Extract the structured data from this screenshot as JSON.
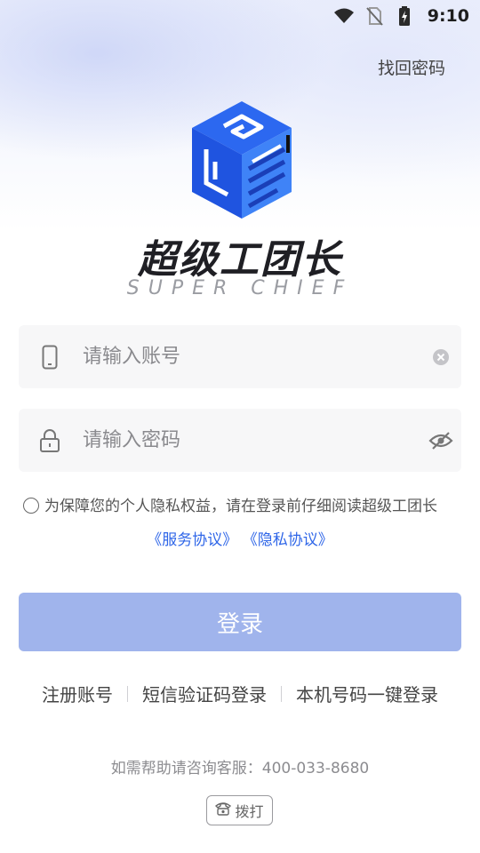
{
  "status_bar": {
    "time": "9:10",
    "icons": [
      "wifi-icon",
      "no-sim-icon",
      "battery-charging-icon"
    ]
  },
  "header": {
    "forgot_password": "找回密码"
  },
  "brand": {
    "name": "超级工团长",
    "subtitle": "SUPER CHIEF",
    "logo_colors": [
      "#1f54e0",
      "#3a7bf5",
      "#1a3fb8"
    ]
  },
  "form": {
    "account": {
      "placeholder": "请输入账号",
      "value": "",
      "icon": "phone-icon",
      "action_icon": "clear-icon"
    },
    "password": {
      "placeholder": "请输入密码",
      "value": "",
      "icon": "lock-icon",
      "action_icon": "eye-off-icon"
    }
  },
  "agreement": {
    "text": "为保障您的个人隐私权益，请在登录前仔细阅读超级工团长",
    "service_link": "《服务协议》",
    "privacy_link": "《隐私协议》",
    "checked": false,
    "link_color": "#2f66e8"
  },
  "login_button": {
    "label": "登录",
    "color": "#a0b4ec"
  },
  "alt_login": {
    "register": "注册账号",
    "sms_login": "短信验证码登录",
    "one_click_login": "本机号码一键登录"
  },
  "help": {
    "text": "如需帮助请咨询客服：400-033-8680",
    "dial_label": "拨打",
    "dial_icon": "telephone-icon"
  }
}
